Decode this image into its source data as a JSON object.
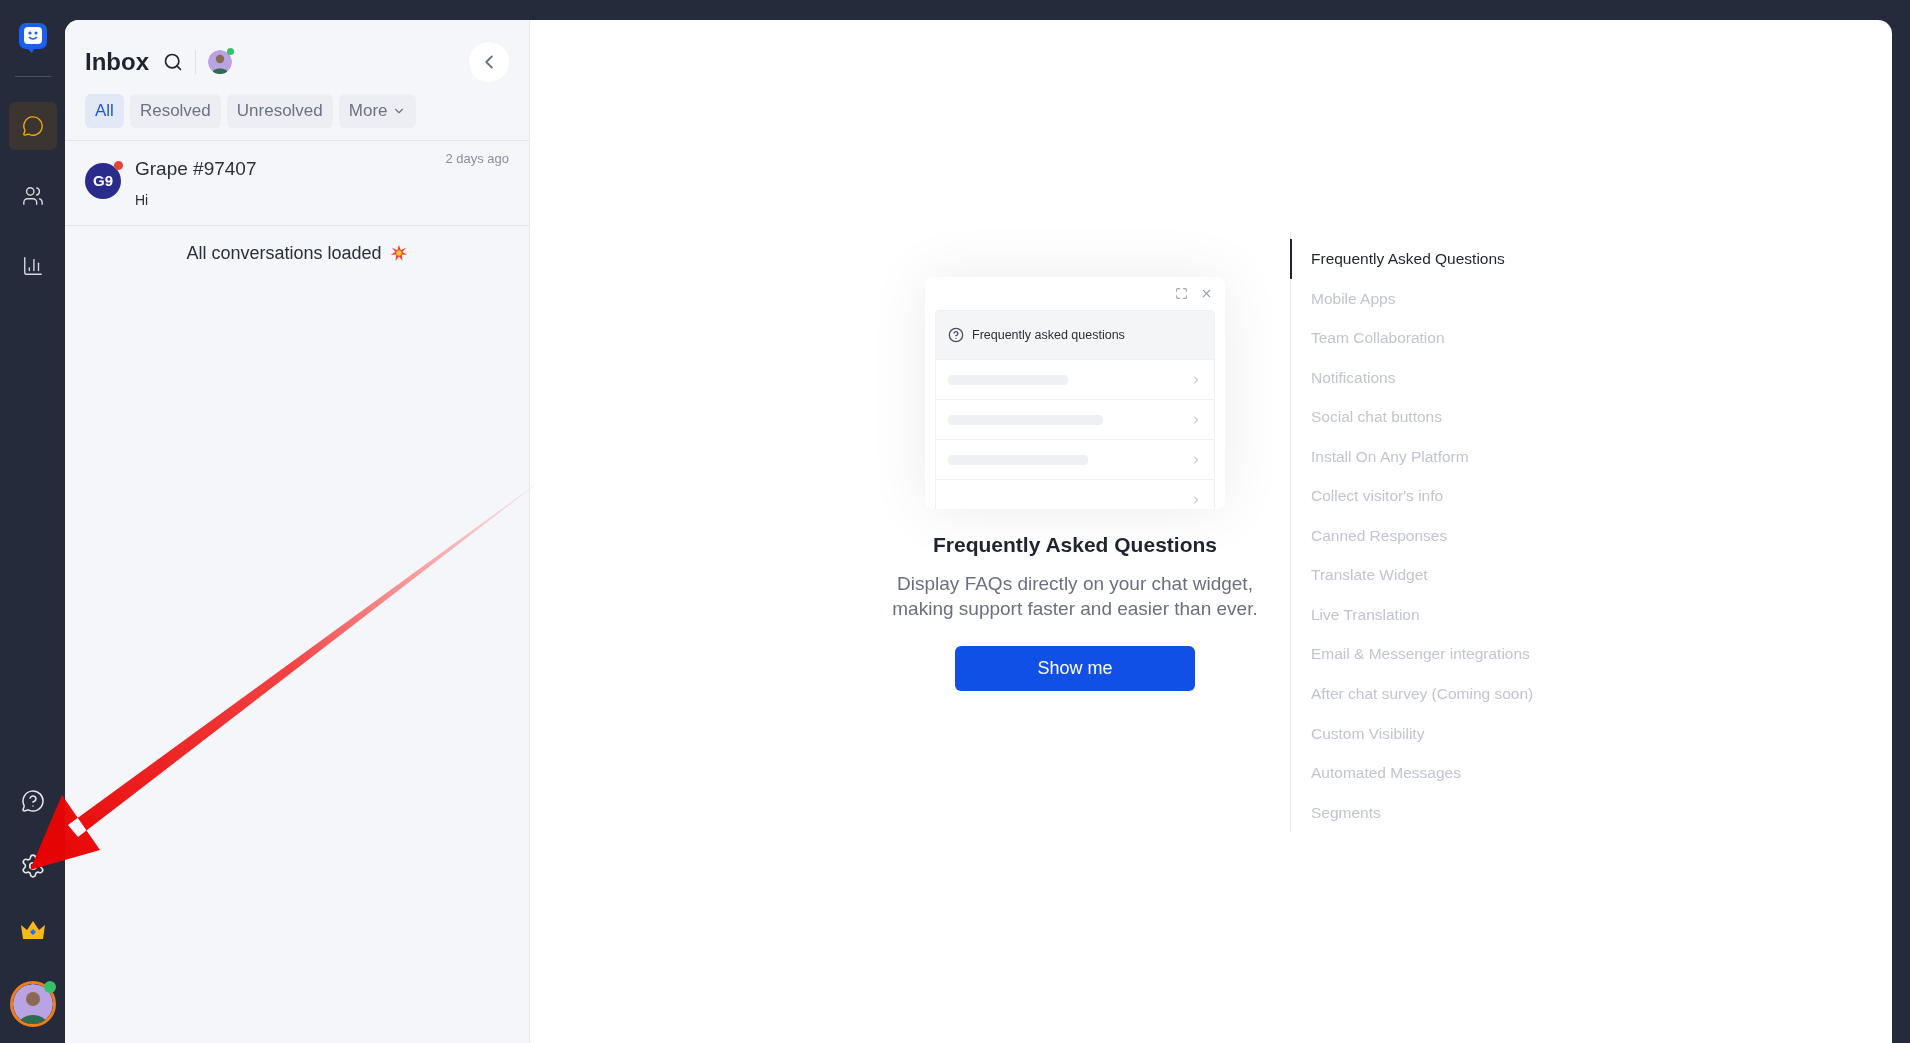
{
  "sidebar": {
    "items": [
      {
        "kind": "chat",
        "selected": true
      },
      {
        "kind": "contacts",
        "selected": false
      },
      {
        "kind": "reports",
        "selected": false
      }
    ]
  },
  "inbox": {
    "title": "Inbox",
    "tabs": [
      {
        "label": "All",
        "selected": true
      },
      {
        "label": "Resolved",
        "selected": false
      },
      {
        "label": "Unresolved",
        "selected": false
      },
      {
        "label": "More",
        "selected": false,
        "dropdown": true
      }
    ],
    "conversations": [
      {
        "initials": "G9",
        "name": "Grape #97407",
        "message": "Hi",
        "time": "2 days ago",
        "unread": true
      }
    ],
    "footer": "All conversations loaded"
  },
  "preview": {
    "widget_title": "Frequently asked questions",
    "title": "Frequently Asked Questions",
    "description": "Display FAQs directly on your chat widget, making support faster and easier than ever.",
    "button": "Show me"
  },
  "features": [
    {
      "label": "Frequently Asked Questions",
      "selected": true
    },
    {
      "label": "Mobile Apps",
      "selected": false
    },
    {
      "label": "Team Collaboration",
      "selected": false
    },
    {
      "label": "Notifications",
      "selected": false
    },
    {
      "label": "Social chat buttons",
      "selected": false
    },
    {
      "label": "Install On Any Platform",
      "selected": false
    },
    {
      "label": "Collect visitor's info",
      "selected": false
    },
    {
      "label": "Canned Responses",
      "selected": false
    },
    {
      "label": "Translate Widget",
      "selected": false
    },
    {
      "label": "Live Translation",
      "selected": false
    },
    {
      "label": "Email & Messenger integrations",
      "selected": false
    },
    {
      "label": "After chat survey (Coming soon)",
      "selected": false
    },
    {
      "label": "Custom Visibility",
      "selected": false
    },
    {
      "label": "Automated Messages",
      "selected": false
    },
    {
      "label": "Segments",
      "selected": false
    }
  ]
}
